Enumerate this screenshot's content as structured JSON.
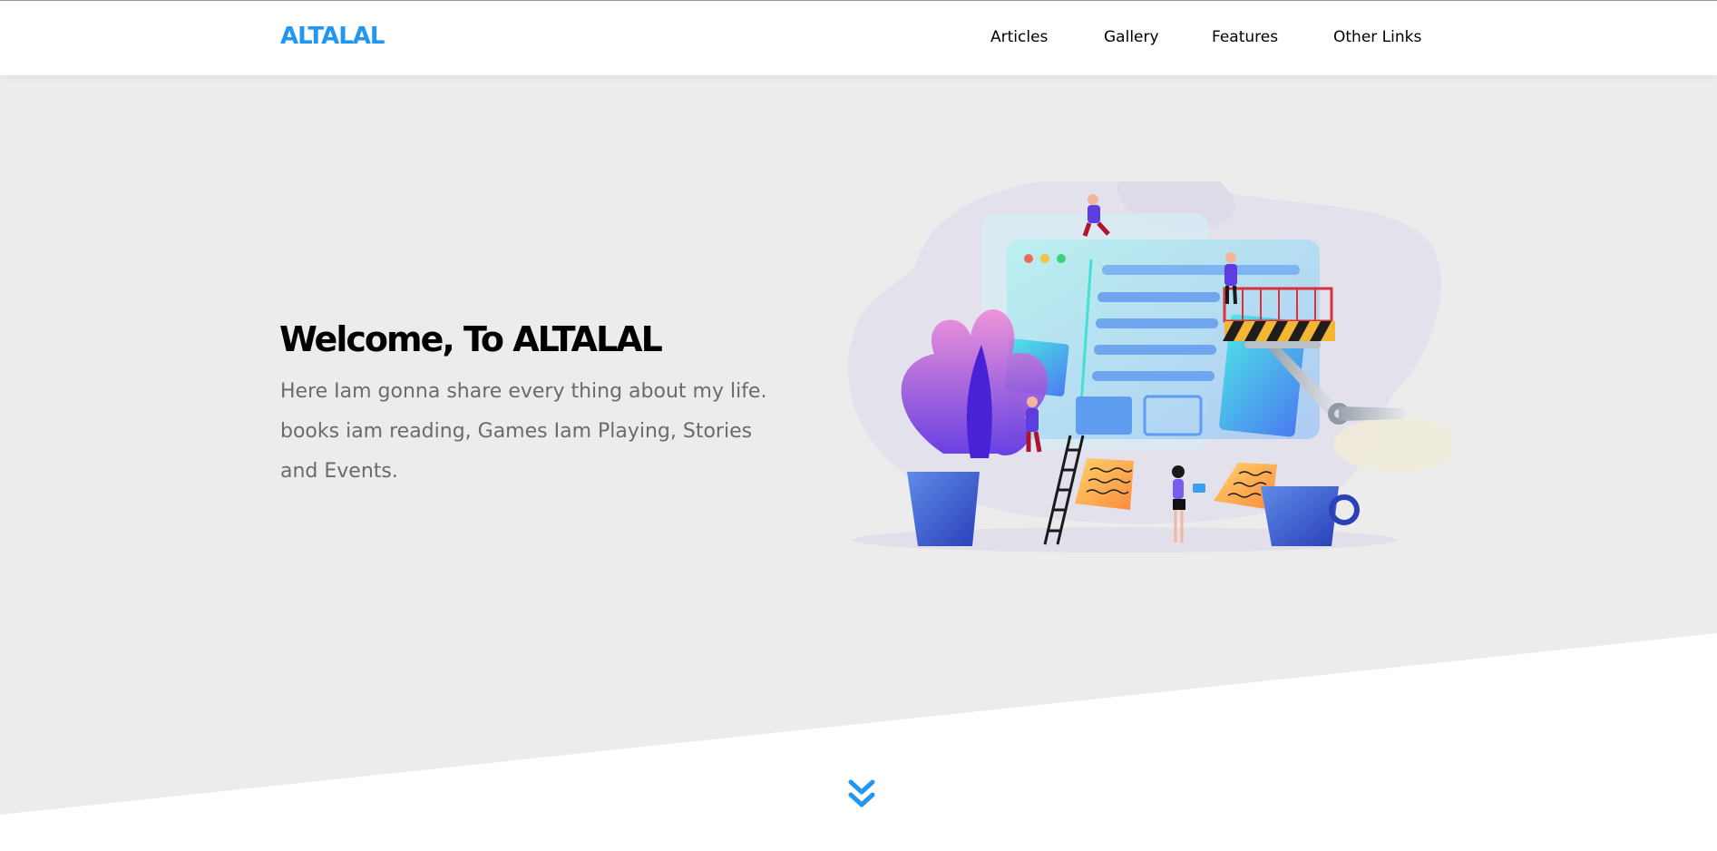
{
  "header": {
    "logo": "ALTALAL",
    "nav": [
      {
        "label": "Articles"
      },
      {
        "label": "Gallery"
      },
      {
        "label": "Features"
      },
      {
        "label": "Other Links"
      }
    ]
  },
  "hero": {
    "title": "Welcome, To ALTALAL",
    "text": "Here Iam gonna share every thing about my life. books iam reading, Games Iam Playing, Stories and Events."
  },
  "colors": {
    "accent": "#2196f3",
    "hero_background": "#ececec",
    "text_muted": "#6b6b6b"
  },
  "icons": {
    "scroll_down": "double-chevron-down-icon"
  }
}
